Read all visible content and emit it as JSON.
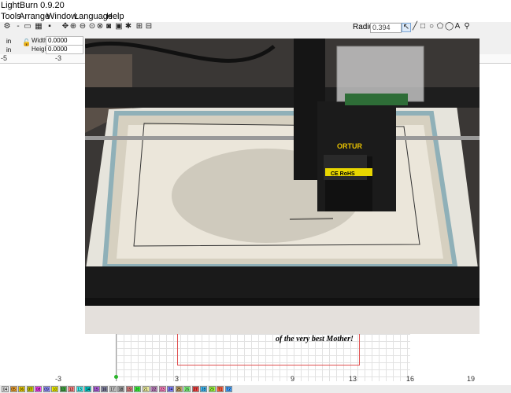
{
  "app": {
    "title": "LightBurn 0.9.20"
  },
  "menu": [
    "Tools",
    "Arrange",
    "Window",
    "Language",
    "Help"
  ],
  "toolbar": {
    "radius_label": "Radius:",
    "radius_value": "0.394"
  },
  "sizebar": {
    "width_label": "Width",
    "width_value": "0.0000",
    "height_label": "Height",
    "height_value": "0.0000",
    "unit": "in"
  },
  "ruler_top": [
    "-5",
    "-3"
  ],
  "ruler_bottom": [
    "-3",
    "3",
    "9",
    "13",
    "16",
    "19"
  ],
  "engraving_text": "of the very best Mother!",
  "photo_labels": {
    "brand": "ORTUR",
    "cert": "CE RoHS"
  },
  "palette": [
    "04",
    "05",
    "06",
    "07",
    "08",
    "09",
    "10",
    "11",
    "12",
    "13",
    "14",
    "15",
    "16",
    "17",
    "18",
    "19",
    "20",
    "21",
    "22",
    "23",
    "24",
    "25",
    "26",
    "27",
    "28",
    "29",
    "T1",
    "T2"
  ],
  "palette_colors": [
    "#e0e0e0",
    "#f0a030",
    "#f0d000",
    "#c8c800",
    "#ff40ff",
    "#9090ff",
    "#f0f000",
    "#40a040",
    "#ff8080",
    "#40f0f0",
    "#00c0c0",
    "#b060e0",
    "#8080a0",
    "#c0c0c0",
    "#a0a0a0",
    "#e08080",
    "#40ff40",
    "#f0f0a0",
    "#c080c0",
    "#ff80c0",
    "#8080ff",
    "#c0a060",
    "#80ff80",
    "#f04040",
    "#40c0ff",
    "#a0ff40",
    "#ff6040",
    "#40a0ff"
  ]
}
